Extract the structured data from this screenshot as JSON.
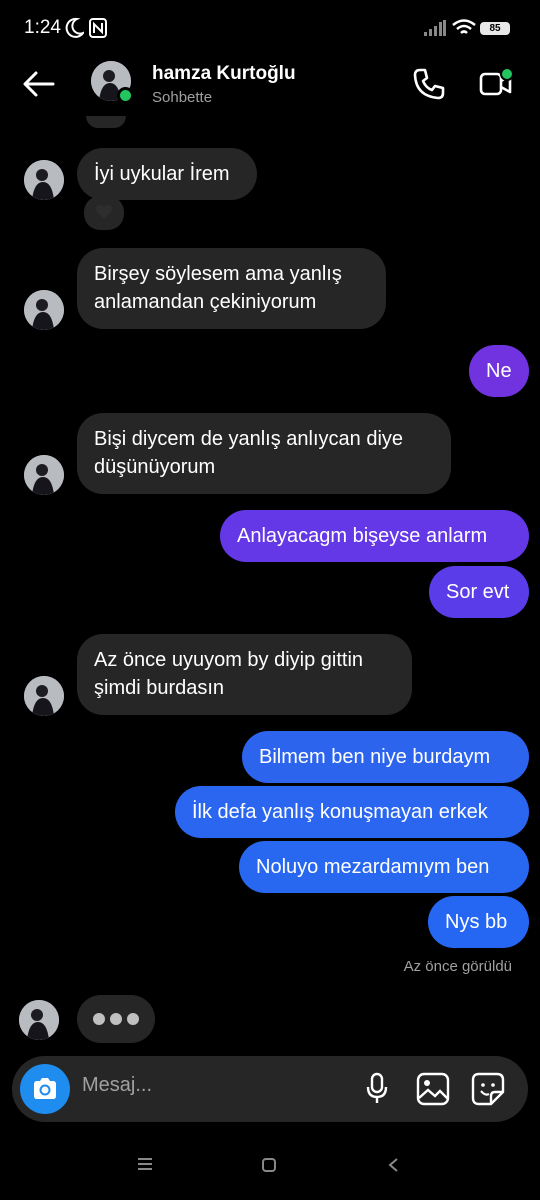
{
  "status_bar": {
    "time": "1:24",
    "battery": "85",
    "icons": [
      "moon-icon",
      "nfc-icon",
      "signal-icon",
      "wifi-icon",
      "battery-icon"
    ]
  },
  "header": {
    "contact_name": "hamza Kurtoğlu",
    "status": "Sohbette",
    "icons": [
      "back-arrow-icon",
      "phone-icon",
      "video-icon"
    ],
    "online_color": "#22c55e"
  },
  "messages": [
    {
      "dir": "in",
      "text": "İyi uykular İrem"
    },
    {
      "dir": "in",
      "text": "Birşey söylesem ama yanlış anlamandan çekiniyorum"
    },
    {
      "dir": "out",
      "text": "Ne"
    },
    {
      "dir": "in",
      "text": "Bişi diycem de yanlış anlıycan diye düşünüyorum"
    },
    {
      "dir": "out",
      "text": "Anlayacagm bişeyse anlarm"
    },
    {
      "dir": "out",
      "text": "Sor evt"
    },
    {
      "dir": "in",
      "text": "Az önce uyuyom by diyip gittin şimdi burdasın"
    },
    {
      "dir": "out",
      "text": "Bilmem ben niye burdaym"
    },
    {
      "dir": "out",
      "text": "İlk defa yanlış konuşmayan erkek"
    },
    {
      "dir": "out",
      "text": "Noluyo mezardamıym ben"
    },
    {
      "dir": "out",
      "text": "Nys bb"
    }
  ],
  "reaction": "heart-icon",
  "seen_label": "Az önce görüldü",
  "composer": {
    "placeholder": "Mesaj...",
    "icons": [
      "camera-icon",
      "microphone-icon",
      "gallery-icon",
      "sticker-icon"
    ]
  },
  "colors": {
    "incoming_bubble": "#262626",
    "outgoing_purple": "#7133e0",
    "outgoing_blue": "#2867f0",
    "camera_button": "#1f8cf0"
  }
}
